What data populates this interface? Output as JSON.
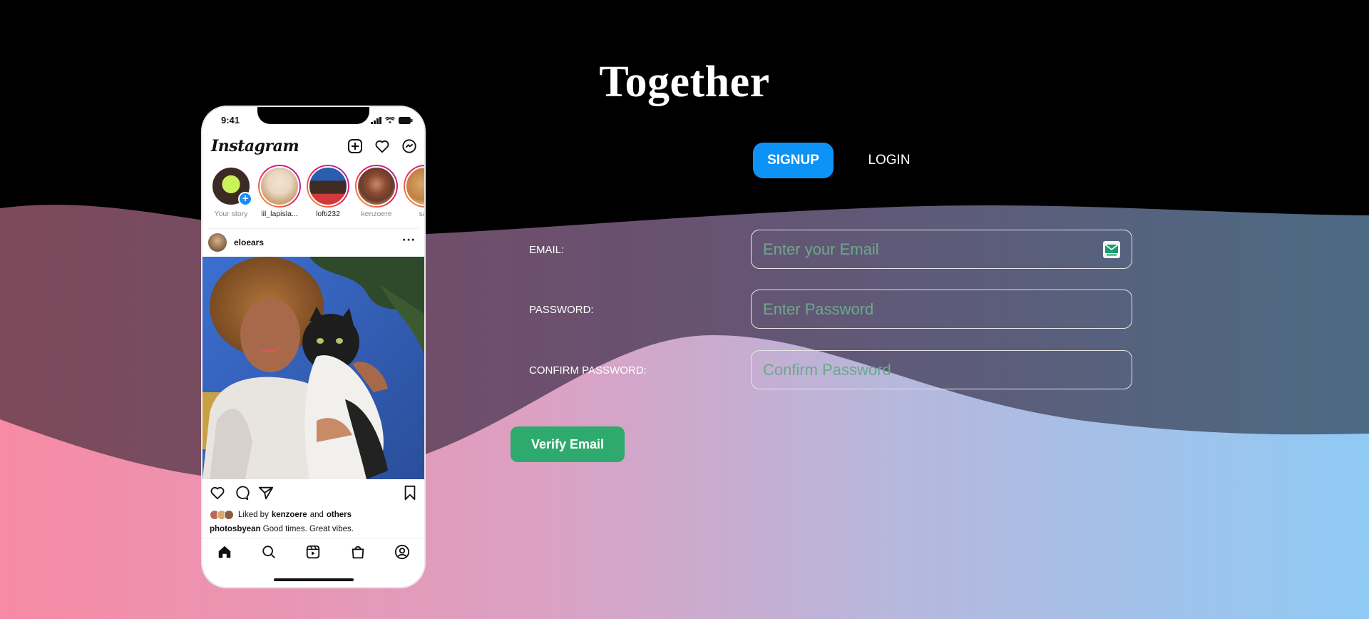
{
  "page": {
    "title": "Together"
  },
  "phone": {
    "status_time": "9:41",
    "app_name": "Instagram",
    "stories": [
      {
        "name": "Your story",
        "own": true,
        "color": "#3b2b24"
      },
      {
        "name": "lil_lapisla...",
        "own": false,
        "color": "#e8d6c0"
      },
      {
        "name": "lofti232",
        "own": false,
        "color": "#3f2a24"
      },
      {
        "name": "kenzoere",
        "own": false,
        "color": "#6a3b2c"
      },
      {
        "name": "sap",
        "own": false,
        "color": "#d9a66b"
      }
    ],
    "post": {
      "username": "eloears",
      "liked_by_prefix": "Liked by",
      "liked_by_user": "kenzoere",
      "liked_by_and": "and",
      "liked_by_others": "others",
      "caption_user": "photosbyean",
      "caption_text": "Good times. Great vibes."
    }
  },
  "auth": {
    "tabs": {
      "signup": "SIGNUP",
      "login": "LOGIN"
    },
    "fields": {
      "email": {
        "label": "EMAIL:",
        "placeholder": "Enter your Email",
        "value": ""
      },
      "password": {
        "label": "PASSWORD:",
        "placeholder": "Enter Password",
        "value": ""
      },
      "confirm": {
        "label": "CONFIRM PASSWORD:",
        "placeholder": "Confirm Password",
        "value": ""
      }
    },
    "verify_button": "Verify Email"
  },
  "colors": {
    "accent_blue": "#0d93f5",
    "verify_green": "#2eaa6e",
    "placeholder_green": "#6aa98a"
  }
}
